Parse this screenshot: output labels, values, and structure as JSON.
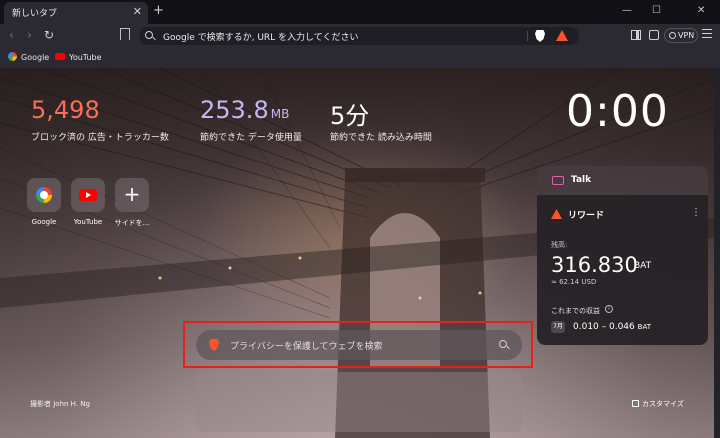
{
  "window": {
    "tab_title": "新しいタブ",
    "tab_close": "✕",
    "new_tab": "+",
    "minimize": "—",
    "maximize": "☐",
    "close": "✕"
  },
  "toolbar": {
    "back": "‹",
    "forward": "›",
    "reload": "↻",
    "url_placeholder": "Google で検索するか, URL を入力してください",
    "vpn_label": "VPN"
  },
  "bookmarks": [
    {
      "label": "Google",
      "icon": "google-icon"
    },
    {
      "label": "YouTube",
      "icon": "youtube-icon"
    }
  ],
  "stats": {
    "ads_blocked": {
      "value": "5,498",
      "label": "ブロック済の 広告・トラッカー数",
      "color": "#fb6e55"
    },
    "data_saved": {
      "value": "253.8",
      "unit": "MB",
      "label": "節約できた データ使用量",
      "color": "#c6b6f0"
    },
    "time_saved": {
      "value": "5分",
      "label": "節約できた 読み込み時間",
      "color": "#ffffff"
    }
  },
  "clock": "0:00",
  "top_sites": [
    {
      "label": "Google",
      "icon": "google-icon"
    },
    {
      "label": "YouTube",
      "icon": "youtube-icon"
    },
    {
      "label": "サイドを...",
      "icon": "plus-icon"
    }
  ],
  "talk": {
    "label": "Talk",
    "accent": "#e061a8"
  },
  "rewards": {
    "title": "リワード",
    "menu": "⋮",
    "balance_label": "残高:",
    "balance": "316.830",
    "balance_unit": "BAT",
    "usd": "≈ 62.14 USD",
    "earnings_label": "これまでの収益",
    "info": "i",
    "month": "7月",
    "earnings_range": "0.010 – 0.046",
    "earnings_unit": "BAT",
    "accent": "#fb542b"
  },
  "search": {
    "placeholder": "プライバシーを保護してウェブを検索",
    "highlight_color": "#e8201b"
  },
  "photo_credit": "撮影者 John H. Ng",
  "customize": "カスタマイズ"
}
